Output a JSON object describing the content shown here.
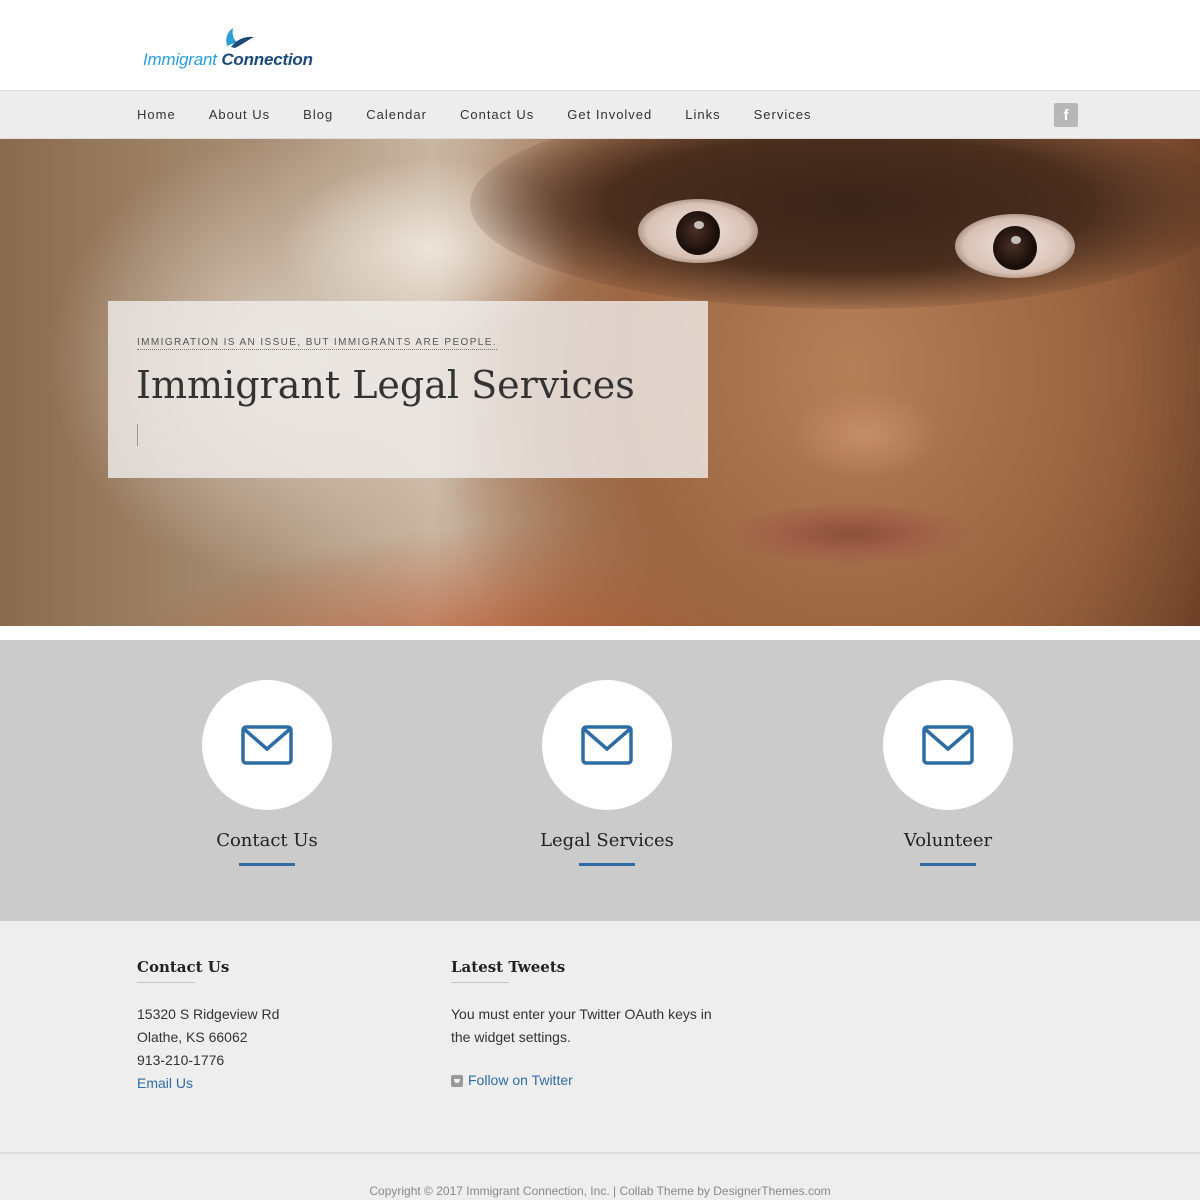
{
  "logo": {
    "part1": "Immigrant",
    "part2": "Connection",
    "icon": "bird-wings-icon",
    "colors": {
      "light": "#2a9fd8",
      "dark": "#1b4a7a"
    }
  },
  "nav": {
    "items": [
      "Home",
      "About Us",
      "Blog",
      "Calendar",
      "Contact Us",
      "Get Involved",
      "Links",
      "Services"
    ],
    "social_icon": "facebook-icon",
    "social_glyph": "f"
  },
  "hero": {
    "kicker": "Immigration is an issue, but immigrants are people.",
    "title": "Immigrant Legal Services"
  },
  "features": [
    {
      "label": "Contact Us",
      "icon": "envelope-icon"
    },
    {
      "label": "Legal Services",
      "icon": "envelope-icon"
    },
    {
      "label": "Volunteer",
      "icon": "envelope-icon"
    }
  ],
  "footer": {
    "contact": {
      "title": "Contact Us",
      "address1": "15320 S Ridgeview Rd",
      "address2": "Olathe, KS 66062",
      "phone": "913-210-1776",
      "email_link": "Email Us"
    },
    "tweets": {
      "title": "Latest Tweets",
      "message_line1": "You must enter your Twitter OAuth keys in",
      "message_line2": "the widget settings.",
      "follow_link": "Follow on Twitter",
      "icon": "twitter-icon"
    }
  },
  "copyright": "Copyright © 2017 Immigrant Connection, Inc. | Collab Theme by DesignerThemes.com",
  "colors": {
    "accent": "#2e6da4",
    "band": "#cbcbcb",
    "nav_bg": "#ededed"
  }
}
